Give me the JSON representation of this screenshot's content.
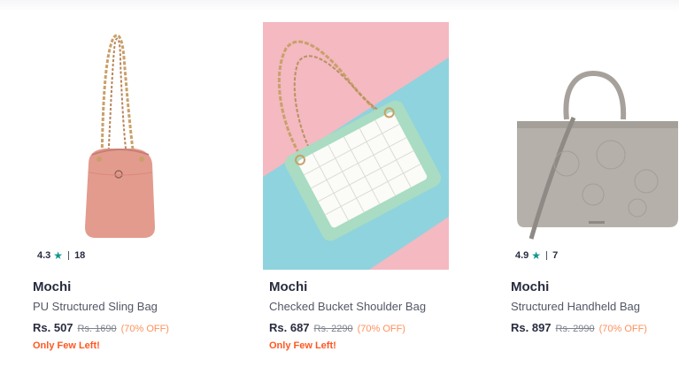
{
  "products": [
    {
      "brand": "Mochi",
      "name": "PU Structured Sling Bag",
      "price": "Rs. 507",
      "mrp": "Rs. 1690",
      "discount": "(70% OFF)",
      "stock_note": "Only Few Left!",
      "rating": "4.3",
      "rating_count": "18"
    },
    {
      "brand": "Mochi",
      "name": "Checked Bucket Shoulder Bag",
      "price": "Rs. 687",
      "mrp": "Rs. 2290",
      "discount": "(70% OFF)",
      "stock_note": "Only Few Left!"
    },
    {
      "brand": "Mochi",
      "name": "Structured Handheld Bag",
      "price": "Rs. 897",
      "mrp": "Rs. 2990",
      "discount": "(70% OFF)",
      "rating": "4.9",
      "rating_count": "7"
    }
  ],
  "colors": {
    "rating_star": "#14958f",
    "discount": "#ff905a",
    "stock_warning": "#ff5722",
    "brand_text": "#282c3f"
  },
  "icons": {
    "rating": "star-icon"
  }
}
